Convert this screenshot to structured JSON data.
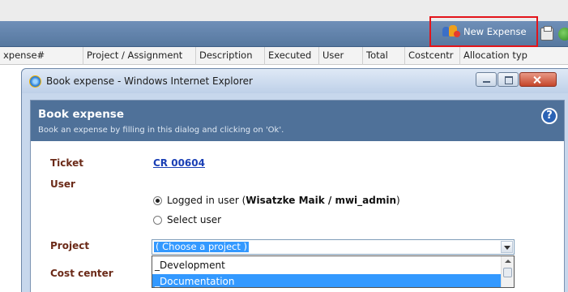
{
  "toolbar": {
    "new_expense_label": "New Expense",
    "print_icon": "printer-icon",
    "extra_icon": "green-icon"
  },
  "columns": [
    "xpense#",
    "Project / Assignment",
    "Description",
    "Executed",
    "User",
    "Total",
    "Costcentr",
    "Allocation typ"
  ],
  "dialog": {
    "window_title": "Book expense - Windows Internet Explorer",
    "title": "Book expense",
    "subtitle": "Book an expense by filling in this dialog and clicking on 'Ok'.",
    "help_symbol": "?",
    "ticket_label": "Ticket",
    "ticket_value": "CR 00604",
    "user_label": "User",
    "logged_in_prefix": "Logged in user (",
    "logged_in_user": "Wisatzke Maik / mwi_admin",
    "logged_in_suffix": ")",
    "select_user_label": "Select user",
    "project_label": "Project",
    "project_selected": "( Choose a project )",
    "cost_center_label": "Cost center",
    "project_options": [
      "_Development",
      "_Documentation"
    ]
  },
  "colors": {
    "toolbar": "#56789f",
    "banner": "#4f7199",
    "highlight_box": "#e3141a",
    "selection": "#3399ff",
    "label": "#6b2a18"
  }
}
